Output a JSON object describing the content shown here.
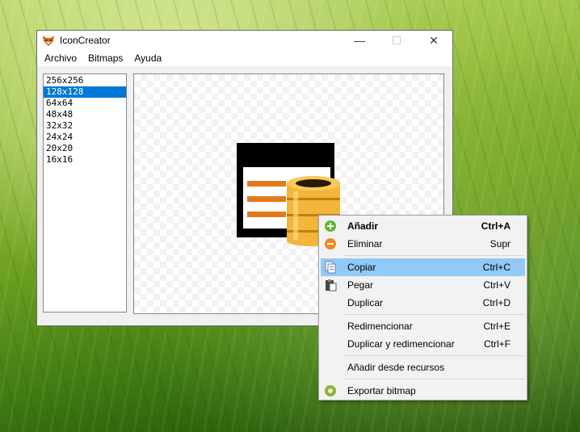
{
  "window": {
    "title": "IconCreator",
    "controls": {
      "minimize": "—",
      "maximize": "☐",
      "close": "✕"
    }
  },
  "menubar": [
    "Archivo",
    "Bitmaps",
    "Ayuda"
  ],
  "sizes": {
    "items": [
      "256x256",
      "128x128",
      "64x64",
      "48x48",
      "32x32",
      "24x24",
      "20x20",
      "16x16"
    ],
    "selected": "128x128"
  },
  "context_menu": {
    "items": [
      {
        "label": "Añadir",
        "shortcut": "Ctrl+A",
        "icon": "plus-icon"
      },
      {
        "label": "Eliminar",
        "shortcut": "Supr",
        "icon": "minus-icon"
      },
      {
        "label": "Copiar",
        "shortcut": "Ctrl+C",
        "icon": "copy-icon"
      },
      {
        "label": "Pegar",
        "shortcut": "Ctrl+V",
        "icon": "paste-icon"
      },
      {
        "label": "Duplicar",
        "shortcut": "Ctrl+D"
      },
      {
        "label": "Redimencionar",
        "shortcut": "Ctrl+E"
      },
      {
        "label": "Duplicar y redimencionar",
        "shortcut": "Ctrl+F"
      },
      {
        "label": "Añadir desde recursos"
      },
      {
        "label": "Exportar bitmap",
        "icon": "export-icon"
      }
    ],
    "highlighted": "Copiar"
  }
}
